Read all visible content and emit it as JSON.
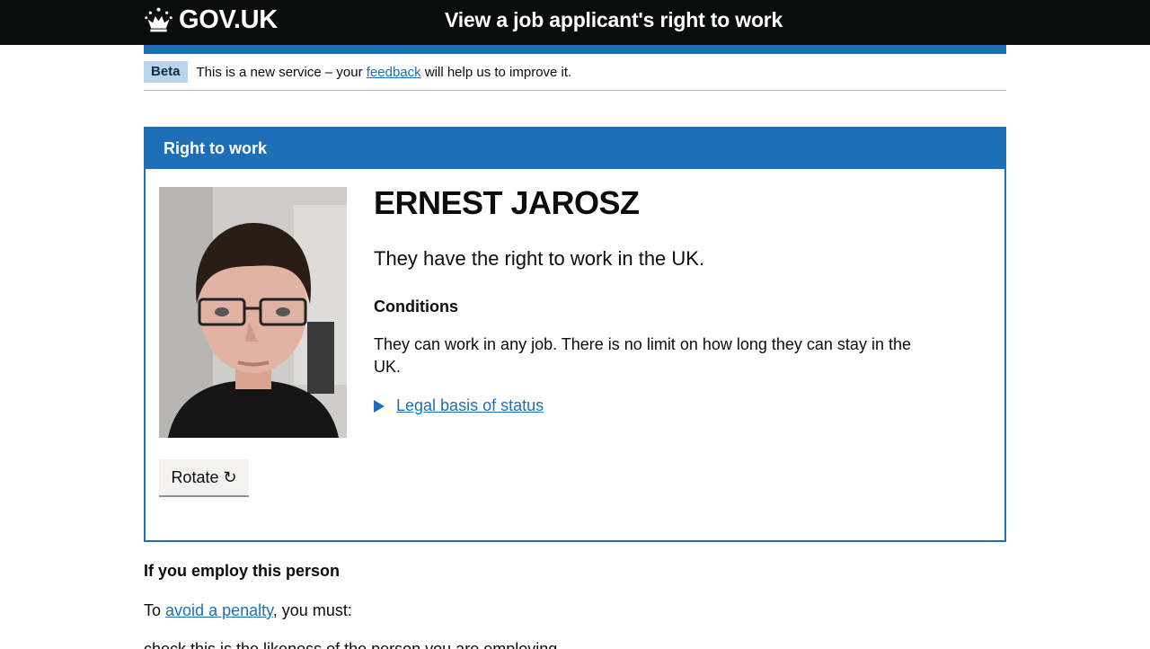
{
  "header": {
    "logo_text": "GOV.UK",
    "service_name": "View a job applicant's right to work"
  },
  "phase_banner": {
    "tag": "Beta",
    "text_before": "This is a new service – your",
    "link": "feedback",
    "text_after": "will help us to improve it."
  },
  "panel": {
    "title": "Right to work",
    "name": "ERNEST JAROSZ",
    "status": "They have the right to work in the UK.",
    "conditions_heading": "Conditions",
    "conditions_text": "They can work in any job. There is no limit on how long they can stay in the UK.",
    "details_link": "Legal basis of status",
    "rotate_button": "Rotate ↻"
  },
  "employ": {
    "heading": "If you employ this person",
    "text_before": "To",
    "link": "avoid a penalty",
    "text_after": ", you must:",
    "cutoff_line": "check this is the likeness of the person you are employing"
  },
  "colors": {
    "header_bg": "#0b0c0c",
    "brand_blue": "#1d70b8",
    "tag_bg": "#bbd4ea",
    "button_bg": "#f3f2f1"
  }
}
